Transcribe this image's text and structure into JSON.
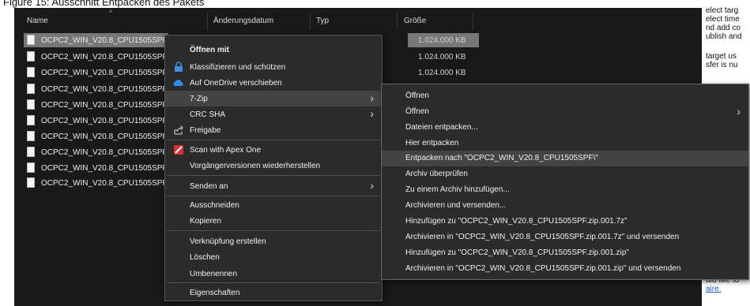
{
  "caption": "Figure 15: Ausschnitt Entpacken des Pakets",
  "explorer": {
    "columns": {
      "name": "Name",
      "date": "Änderungsdatum",
      "type": "Typ",
      "size": "Größe"
    },
    "files": [
      {
        "name": "OCPC2_WIN_V20.8_CPU1505SPF.",
        "size": "1.024.000 KB"
      },
      {
        "name": "OCPC2_WIN_V20.8_CPU1505SPF.",
        "size": "1.024.000 KB"
      },
      {
        "name": "OCPC2_WIN_V20.8_CPU1505SPF.",
        "size": "1.024.000 KB"
      },
      {
        "name": "OCPC2_WIN_V20.8_CPU1505SPF.",
        "size": ""
      },
      {
        "name": "OCPC2_WIN_V20.8_CPU1505SPF.",
        "size": ""
      },
      {
        "name": "OCPC2_WIN_V20.8_CPU1505SPF.",
        "size": ""
      },
      {
        "name": "OCPC2_WIN_V20.8_CPU1505SPF.",
        "size": ""
      },
      {
        "name": "OCPC2_WIN_V20.8_CPU1505SPF.",
        "size": ""
      },
      {
        "name": "OCPC2_WIN_V20.8_CPU1505SPF.",
        "size": ""
      },
      {
        "name": "OCPC2_WIN_V20.8_CPU1505SPF.",
        "size": ""
      }
    ]
  },
  "context_menu": {
    "open_with": "Öffnen mit",
    "classify": "Klassifizieren und schützen",
    "onedrive": "Auf OneDrive verschieben",
    "seven_zip": "7-Zip",
    "crc_sha": "CRC SHA",
    "share": "Freigabe",
    "apex": "Scan with Apex One",
    "restore": "Vorgängerversionen wiederherstellen",
    "send_to": "Senden an",
    "cut": "Ausschneiden",
    "copy": "Kopieren",
    "shortcut": "Verknüpfung erstellen",
    "delete": "Löschen",
    "rename": "Umbenennen",
    "properties": "Eigenschaften"
  },
  "submenu_7zip": {
    "items": [
      "Öffnen",
      "Öffnen",
      "Dateien entpacken...",
      "Hier entpacken",
      "Entpacken nach \"OCPC2_WIN_V20.8_CPU1505SPF\\\"",
      "Archiv überprüfen",
      "Zu einem Archiv hinzufügen...",
      "Archivieren und versenden...",
      "Hinzufügen zu \"OCPC2_WIN_V20.8_CPU1505SPF.zip.001.7z\"",
      "Archivieren in \"OCPC2_WIN_V20.8_CPU1505SPF.zip.001.7z\" und versenden",
      "Hinzufügen zu \"OCPC2_WIN_V20.8_CPU1505SPF.zip.001.zip\"",
      "Archivieren in \"OCPC2_WIN_V20.8_CPU1505SPF.zip.001.zip\" und versenden"
    ]
  },
  "doc_side_text": {
    "line1": "elect targ",
    "line2": "elect time",
    "line3": "nd add co",
    "line4": "ublish and",
    "line5": "target us",
    "line6": "sfer is nu",
    "line7": "uld like to",
    "line8": "aire."
  },
  "colors": {
    "explorer_bg": "#191919",
    "menu_bg": "#2b2b2b",
    "highlight": "#434343",
    "selection": "#777777"
  }
}
